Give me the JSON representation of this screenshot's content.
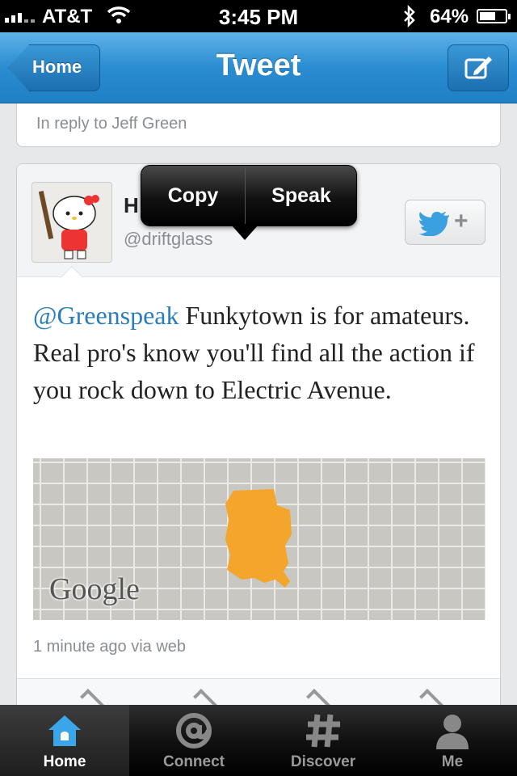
{
  "status_bar": {
    "carrier": "AT&T",
    "time": "3:45 PM",
    "battery": "64%",
    "battery_level": 0.64
  },
  "nav": {
    "back_label": "Home",
    "title": "Tweet"
  },
  "reply_context": "In reply to Jeff Green",
  "tweet": {
    "name_fragment": "H",
    "handle": "@driftglass",
    "mention": "@Greenspeak",
    "body": " Funkytown is for amateurs. Real pro's know you'll find all the action if you rock down to Electric Avenue.",
    "map_attribution": "Google",
    "meta": "1 minute ago via web"
  },
  "popover": {
    "copy_label": "Copy",
    "speak_label": "Speak"
  },
  "tabs": [
    {
      "label": "Home",
      "icon": "home-icon",
      "active": true
    },
    {
      "label": "Connect",
      "icon": "at-icon",
      "active": false
    },
    {
      "label": "Discover",
      "icon": "hash-icon",
      "active": false
    },
    {
      "label": "Me",
      "icon": "person-icon",
      "active": false
    }
  ],
  "colors": {
    "nav_blue": "#2a8cd1",
    "mention_blue": "#2a7dbd",
    "map_region": "#f3a52c"
  }
}
